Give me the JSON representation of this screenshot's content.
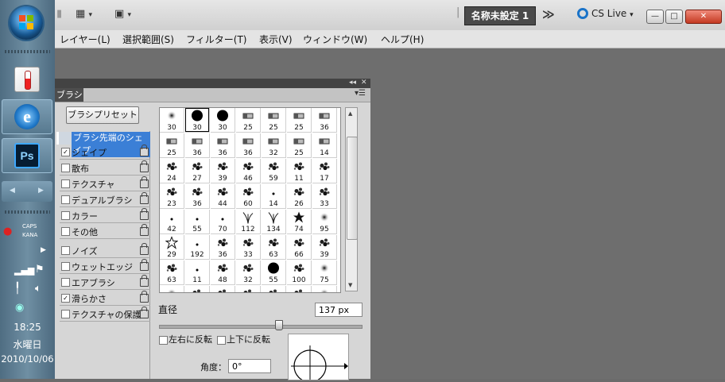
{
  "taskbar": {
    "tray": {
      "caps": "CAPS",
      "kana": "KANA"
    },
    "clock": {
      "time": "18:25",
      "day": "水曜日",
      "date": "2010/10/06"
    },
    "apps": [
      "hardware-monitor",
      "internet-explorer",
      "photoshop"
    ],
    "ps_label": "Ps",
    "ie_label": "e"
  },
  "appbar": {
    "doc_tab": "名称未設定 1",
    "more": "≫",
    "cs_live": "CS Live",
    "cs_live_arrow": "▾",
    "arrange_arrow": "▾",
    "screen_arrow": "▾",
    "window_buttons": {
      "minimize": "—",
      "maximize": "□",
      "close": "✕"
    }
  },
  "menubar": {
    "items": [
      "レイヤー(L)",
      "選択範囲(S)",
      "フィルター(T)",
      "表示(V)",
      "ウィンドウ(W)",
      "ヘルプ(H)"
    ]
  },
  "brush_panel": {
    "tab": "ブラシ",
    "collapse": "◂◂",
    "close": "✕",
    "menu": "▾☰",
    "preset_button": "ブラシプリセット",
    "tip_shape_header": "ブラシ先端のシェイプ",
    "options": [
      {
        "label": "シェイプ",
        "checked": true
      },
      {
        "label": "散布",
        "checked": false
      },
      {
        "label": "テクスチャ",
        "checked": false
      },
      {
        "label": "デュアルブラシ",
        "checked": false
      },
      {
        "label": "カラー",
        "checked": false
      },
      {
        "label": "その他",
        "checked": false
      },
      {
        "label": "ノイズ",
        "checked": false
      },
      {
        "label": "ウェットエッジ",
        "checked": false
      },
      {
        "label": "エアブラシ",
        "checked": false
      },
      {
        "label": "滑らかさ",
        "checked": true
      },
      {
        "label": "テクスチャの保護",
        "checked": false
      }
    ],
    "brushes": [
      [
        {
          "size": "30",
          "kind": "soft"
        },
        {
          "size": "30",
          "kind": "hard"
        },
        {
          "size": "30",
          "kind": "hard"
        },
        {
          "size": "25",
          "kind": "stroke"
        },
        {
          "size": "25",
          "kind": "stroke"
        },
        {
          "size": "25",
          "kind": "stroke"
        },
        {
          "size": "36",
          "kind": "stroke"
        }
      ],
      [
        {
          "size": "25",
          "kind": "stroke"
        },
        {
          "size": "36",
          "kind": "stroke"
        },
        {
          "size": "36",
          "kind": "stroke"
        },
        {
          "size": "36",
          "kind": "stroke"
        },
        {
          "size": "32",
          "kind": "stroke"
        },
        {
          "size": "25",
          "kind": "stroke"
        },
        {
          "size": "14",
          "kind": "stroke"
        }
      ],
      [
        {
          "size": "24",
          "kind": "splat"
        },
        {
          "size": "27",
          "kind": "splat"
        },
        {
          "size": "39",
          "kind": "splat"
        },
        {
          "size": "46",
          "kind": "splat"
        },
        {
          "size": "59",
          "kind": "splat"
        },
        {
          "size": "11",
          "kind": "splat"
        },
        {
          "size": "17",
          "kind": "splat"
        }
      ],
      [
        {
          "size": "23",
          "kind": "splat"
        },
        {
          "size": "36",
          "kind": "splat"
        },
        {
          "size": "44",
          "kind": "splat"
        },
        {
          "size": "60",
          "kind": "splat"
        },
        {
          "size": "14",
          "kind": "dot"
        },
        {
          "size": "26",
          "kind": "splat"
        },
        {
          "size": "33",
          "kind": "splat"
        }
      ],
      [
        {
          "size": "42",
          "kind": "dot"
        },
        {
          "size": "55",
          "kind": "dot"
        },
        {
          "size": "70",
          "kind": "dot"
        },
        {
          "size": "112",
          "kind": "grass"
        },
        {
          "size": "134",
          "kind": "grass"
        },
        {
          "size": "74",
          "kind": "leaf"
        },
        {
          "size": "95",
          "kind": "soft"
        }
      ],
      [
        {
          "size": "29",
          "kind": "star"
        },
        {
          "size": "192",
          "kind": "dot"
        },
        {
          "size": "36",
          "kind": "splat"
        },
        {
          "size": "33",
          "kind": "splat"
        },
        {
          "size": "63",
          "kind": "splat"
        },
        {
          "size": "66",
          "kind": "splat"
        },
        {
          "size": "39",
          "kind": "splat"
        }
      ],
      [
        {
          "size": "63",
          "kind": "splat"
        },
        {
          "size": "11",
          "kind": "dot"
        },
        {
          "size": "48",
          "kind": "splat"
        },
        {
          "size": "32",
          "kind": "splat"
        },
        {
          "size": "55",
          "kind": "hard"
        },
        {
          "size": "100",
          "kind": "splat"
        },
        {
          "size": "75",
          "kind": "soft"
        }
      ],
      [
        {
          "size": "",
          "kind": "soft"
        },
        {
          "size": "",
          "kind": "splat"
        },
        {
          "size": "",
          "kind": "splat"
        },
        {
          "size": "",
          "kind": "splat"
        },
        {
          "size": "",
          "kind": "splat"
        },
        {
          "size": "",
          "kind": "splat"
        },
        {
          "size": "",
          "kind": "soft"
        }
      ]
    ],
    "diameter_label": "直径",
    "diameter_value": "137 px",
    "diameter_slider_fraction": 0.59,
    "flip_x_label": "左右に反転",
    "flip_y_label": "上下に反転",
    "angle_label": "角度：",
    "angle_value": "0°"
  },
  "colors": {
    "workspace": "#6e6e6e",
    "selection": "#3b7fd6",
    "panel_bg": "#d6d6d6",
    "doc_tab_bg": "#4a4a4a"
  }
}
